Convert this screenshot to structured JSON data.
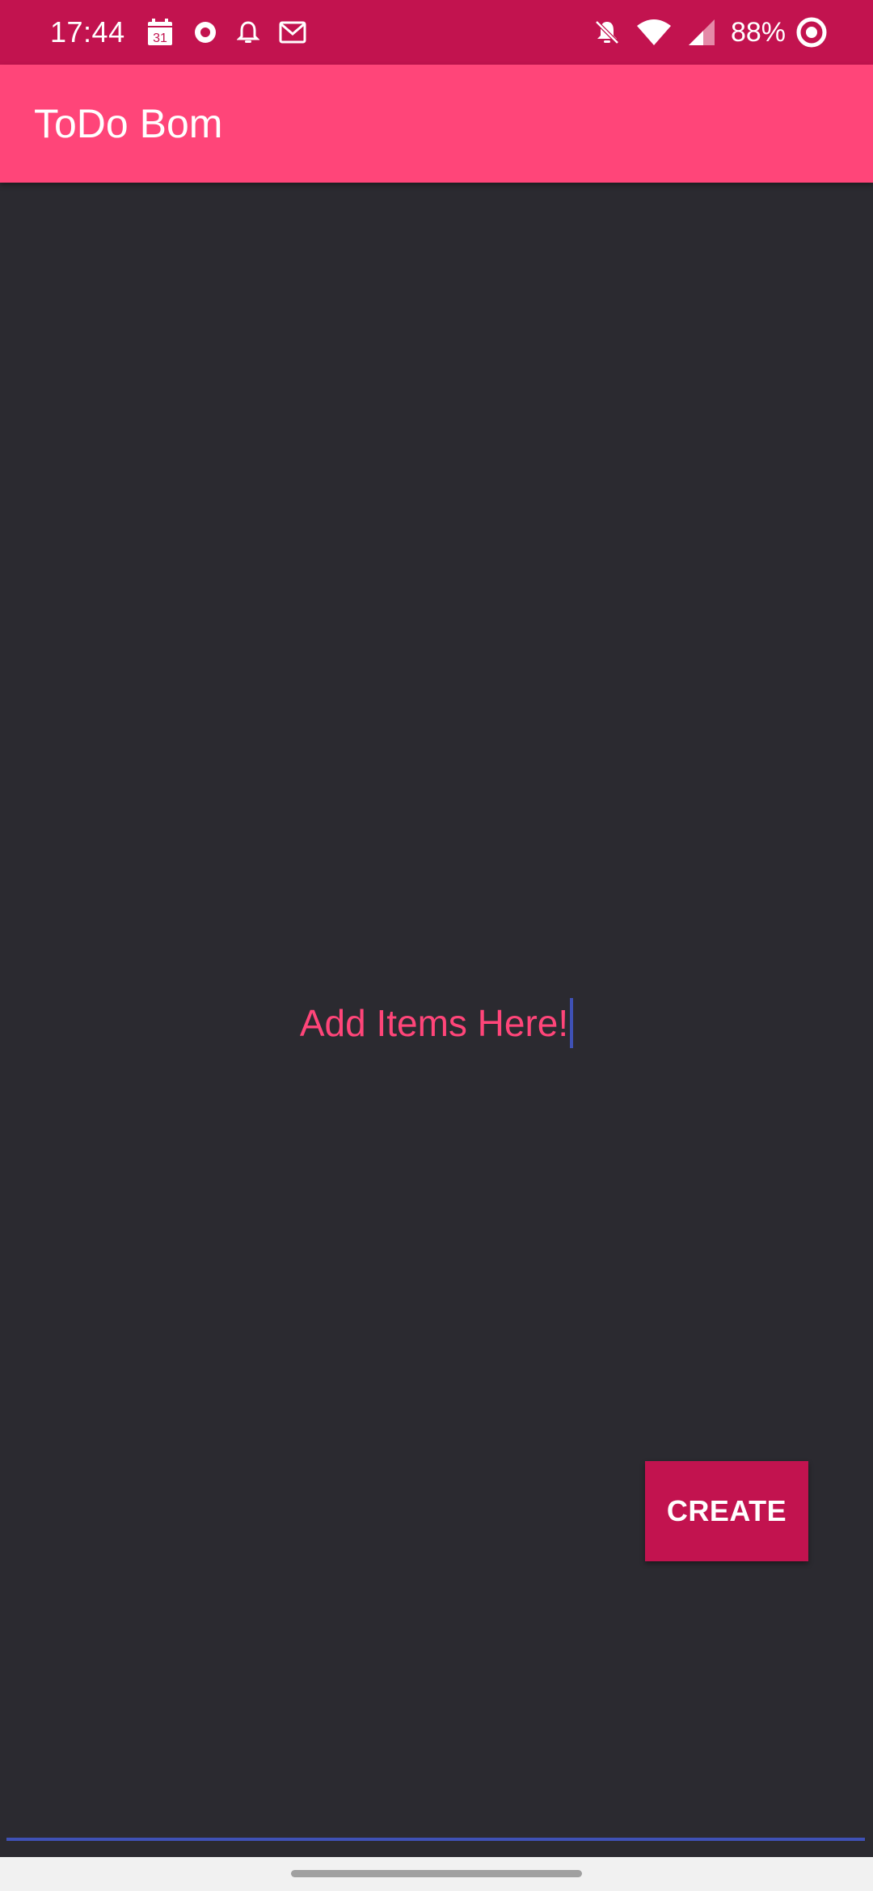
{
  "status_bar": {
    "time": "17:44",
    "calendar_day": "31",
    "battery_percent": "88%",
    "left_icons": [
      "calendar-icon",
      "record-icon",
      "bell-icon",
      "gmail-icon"
    ],
    "right_icons": [
      "bell-muted-icon",
      "wifi-icon",
      "cell-signal-icon",
      "battery-ring-icon"
    ]
  },
  "app_bar": {
    "title": "ToDo Bom",
    "color": "#ff4579"
  },
  "main": {
    "input_hint": "Add Items Here!",
    "hint_color": "#ff4579",
    "background": "#2b2a30"
  },
  "actions": {
    "create_label": "CREATE",
    "create_color": "#c2134f"
  }
}
